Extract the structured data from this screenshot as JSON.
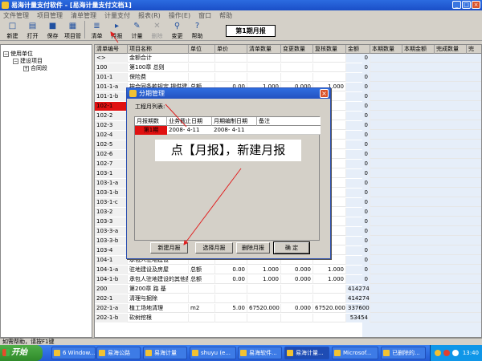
{
  "window": {
    "title": "易海计量支付软件 - [易海计量支付文档1]",
    "min": "_",
    "max": "□",
    "close": "×"
  },
  "menu": [
    "文件管理",
    "项目管理",
    "清单管理",
    "计量支付",
    "报表(R)",
    "操作(E)",
    "窗口",
    "帮助"
  ],
  "toolbar": [
    {
      "label": "新建",
      "icon": "new-file-icon",
      "glyph": "□"
    },
    {
      "label": "打开",
      "icon": "open-folder-icon",
      "glyph": "▤"
    },
    {
      "label": "保存",
      "icon": "save-icon",
      "glyph": "■"
    },
    {
      "label": "项目管",
      "icon": "project-icon",
      "glyph": "▦"
    },
    {
      "label": "清单",
      "icon": "list-icon",
      "glyph": "≣"
    },
    {
      "label": "月报",
      "icon": "monthly-report-icon",
      "glyph": "▸"
    },
    {
      "label": "计量",
      "icon": "measure-icon",
      "glyph": "✎"
    },
    {
      "label": "删除",
      "icon": "delete-icon",
      "glyph": "✕"
    },
    {
      "label": "变更",
      "icon": "change-icon",
      "glyph": "⚲"
    },
    {
      "label": "帮助",
      "icon": "help-icon",
      "glyph": "?"
    }
  ],
  "period": "第1期月报",
  "tree": [
    {
      "label": "使用单位",
      "pm": "−"
    },
    {
      "label": "建设项目",
      "pm": "−"
    },
    {
      "label": "合同段",
      "pm": "+"
    }
  ],
  "grid": {
    "columns": [
      "清单编号",
      "项目名称",
      "单位",
      "单价",
      "清单数量",
      "变更数量",
      "复核数量",
      "金额",
      "本期数量",
      "本期金额",
      "完成数量",
      "完"
    ],
    "rows": [
      [
        "<>",
        "金额合计",
        "",
        "",
        "",
        "",
        "",
        "0"
      ],
      [
        "100",
        "第100章  总则",
        "",
        "",
        "",
        "",
        "",
        "0"
      ],
      [
        "101-1",
        "保险费",
        "",
        "",
        "",
        "",
        "",
        "0"
      ],
      [
        "101-1-a",
        "按合同条款规定,提供建",
        "总额",
        "0.00",
        "1.000",
        "0.000",
        "1.000",
        "0"
      ],
      [
        "101-1-b",
        "",
        "",
        "",
        "",
        "",
        "",
        "0"
      ],
      [
        "102-1",
        "",
        "",
        "",
        "",
        "",
        "",
        "0"
      ],
      [
        "102-2",
        "",
        "",
        "",
        "",
        "",
        "",
        "0"
      ],
      [
        "102-3",
        "",
        "",
        "",
        "",
        "",
        "",
        "0"
      ],
      [
        "102-4",
        "",
        "",
        "",
        "",
        "",
        "",
        "0"
      ],
      [
        "102-5",
        "",
        "",
        "",
        "",
        "",
        "",
        "0"
      ],
      [
        "102-6",
        "",
        "",
        "",
        "",
        "",
        "",
        "0"
      ],
      [
        "102-7",
        "",
        "",
        "",
        "",
        "",
        "",
        "0"
      ],
      [
        "103-1",
        "",
        "",
        "",
        "",
        "",
        "",
        "0"
      ],
      [
        "103-1-a",
        "",
        "",
        "",
        "",
        "",
        "",
        "0"
      ],
      [
        "103-1-b",
        "",
        "",
        "",
        "",
        "",
        "",
        "0"
      ],
      [
        "103-1-c",
        "",
        "",
        "",
        "",
        "",
        "",
        "0"
      ],
      [
        "103-2",
        "",
        "",
        "",
        "",
        "",
        "",
        "0"
      ],
      [
        "103-3",
        "",
        "",
        "",
        "",
        "",
        "",
        "0"
      ],
      [
        "103-3-a",
        "",
        "",
        "",
        "",
        "",
        "",
        "0"
      ],
      [
        "103-3-b",
        "",
        "",
        "",
        "",
        "",
        "",
        "0"
      ],
      [
        "103-4",
        "",
        "",
        "",
        "",
        "",
        "",
        "0"
      ],
      [
        "104-1",
        "承包人驻地建设",
        "",
        "",
        "",
        "",
        "",
        "0"
      ],
      [
        "104-1-a",
        "驻地建设及房屋",
        "总额",
        "0.00",
        "1.000",
        "0.000",
        "1.000",
        "0"
      ],
      [
        "104-1-b",
        "承包人驻地建设的其他费",
        "总额",
        "0.00",
        "1.000",
        "0.000",
        "1.000",
        "0"
      ],
      [
        "200",
        "第200章  路  基",
        "",
        "",
        "",
        "",
        "",
        "414274"
      ],
      [
        "202-1",
        "清理与掘除",
        "",
        "",
        "",
        "",
        "",
        "414274"
      ],
      [
        "202-1-a",
        "植工场地清理",
        "m2",
        "5.00",
        "67520.000",
        "0.000",
        "67520.000",
        "337600"
      ],
      [
        "202-1-b",
        "砍树挖根",
        "",
        "",
        "",
        "",
        "",
        "53454"
      ]
    ]
  },
  "dialog": {
    "title": "分期管理",
    "close": "×",
    "list_label": "工程月列表:",
    "columns": [
      "月报期数",
      "业务截止日期",
      "月期编制日期",
      "备注"
    ],
    "row": [
      "第1期",
      "2008- 4-11",
      "2008- 4-11",
      ""
    ],
    "buttons": [
      "新建月报",
      "选择月报",
      "删除月报",
      "确  定"
    ]
  },
  "callout": "点【月报】，新建月报",
  "status": "如需帮助，请按F1键",
  "taskbar": {
    "start": "开始",
    "tasks": [
      "6 Window...",
      "易海公路",
      "易海计量",
      "shuyu (e...",
      "易海软件...",
      "易海计量...",
      "Microsof...",
      "已删除的..."
    ],
    "time": "13:40"
  },
  "colors": {
    "selected": "#e01010",
    "arrow": "#e02020",
    "title_bar": "#1a4fc7"
  }
}
